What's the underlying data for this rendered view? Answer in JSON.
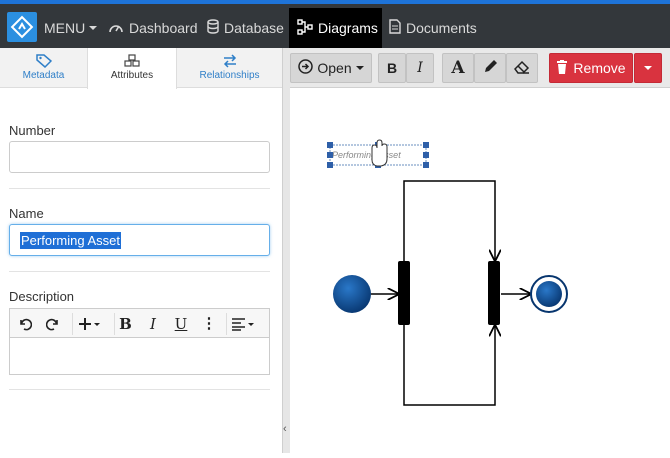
{
  "nav": {
    "menu_label": "MENU",
    "items": [
      {
        "label": "Dashboard",
        "icon": "gauge-icon"
      },
      {
        "label": "Database",
        "icon": "database-icon"
      },
      {
        "label": "Diagrams",
        "icon": "diagram-icon",
        "active": true
      },
      {
        "label": "Documents",
        "icon": "document-icon"
      }
    ],
    "accent_color": "#1e73d8"
  },
  "left_panel": {
    "tabs": [
      {
        "label": "Metadata",
        "icon": "tag-icon"
      },
      {
        "label": "Attributes",
        "icon": "cubes-icon",
        "active": true
      },
      {
        "label": "Relationships",
        "icon": "swap-arrows-icon"
      }
    ],
    "fields": {
      "number_label": "Number",
      "number_value": "",
      "name_label": "Name",
      "name_value": "Performing Asset",
      "description_label": "Description",
      "description_value": ""
    },
    "editor_toolbar": [
      "undo-icon",
      "redo-icon",
      "insert-plus-icon",
      "bold-icon",
      "italic-icon",
      "underline-icon",
      "more-icon",
      "align-icon"
    ]
  },
  "toolbar": {
    "open_label": "Open",
    "remove_label": "Remove",
    "buttons": [
      "bold-icon",
      "italic-icon",
      "text-color-icon",
      "pencil-icon",
      "eraser-icon"
    ]
  },
  "diagram": {
    "selected_label": "Performing Asset",
    "node_color": "#0b4a8f"
  }
}
